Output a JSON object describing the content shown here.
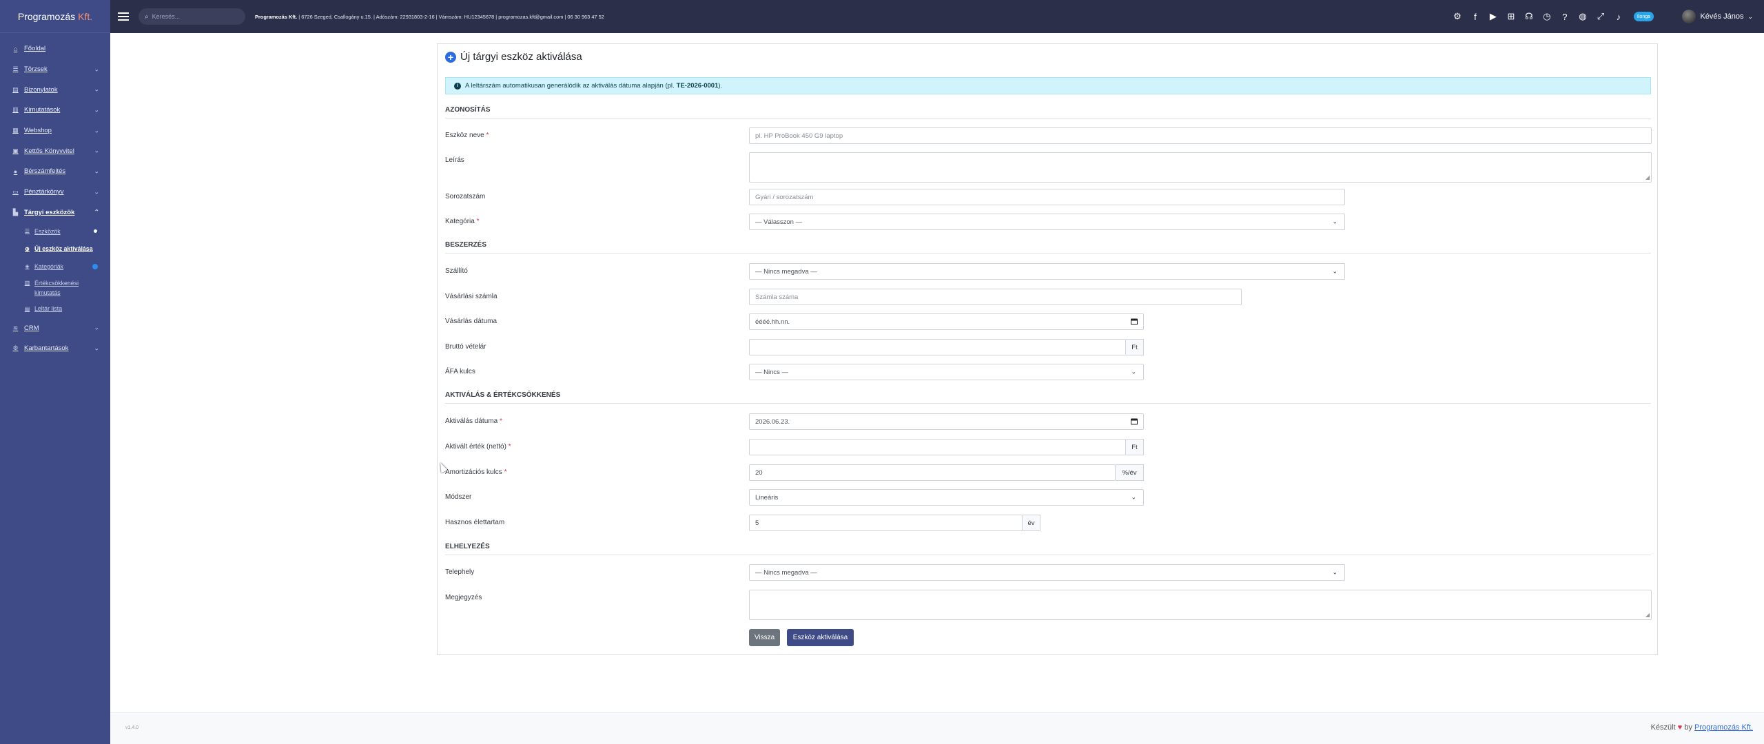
{
  "sidebar": {
    "brand": {
      "name": "Programozás",
      "suffix": "Kft."
    },
    "items": [
      {
        "label": "Főoldal",
        "icon": "dashboard-icon"
      },
      {
        "label": "Törzsek",
        "icon": "database-icon"
      },
      {
        "label": "Bizonylatok",
        "icon": "document-icon"
      },
      {
        "label": "Kimutatások",
        "icon": "chart-icon"
      },
      {
        "label": "Webshop",
        "icon": "shop-icon"
      },
      {
        "label": "Kettős Könyvvitel",
        "icon": "book-icon"
      },
      {
        "label": "Bérszámfejtés",
        "icon": "users-icon"
      },
      {
        "label": "Pénztárkönyv",
        "icon": "cash-icon"
      },
      {
        "label": "Tárgyi eszközök",
        "icon": "asset-icon"
      }
    ],
    "sub_items": [
      {
        "label": "Eszközök",
        "icon": "list-icon"
      },
      {
        "label": "Új eszköz aktiválása",
        "icon": "plus-circle-icon"
      },
      {
        "label": "Kategóriák",
        "icon": "tags-icon"
      },
      {
        "label": "Értékcsökkenési kimutatás",
        "icon": "chart-line-icon"
      },
      {
        "label": "Leltár lista",
        "icon": "clipboard-icon"
      }
    ],
    "after_items": [
      {
        "label": "CRM",
        "icon": "crm-icon"
      },
      {
        "label": "Karbantartások",
        "icon": "gear-icon"
      }
    ]
  },
  "topbar": {
    "search_placeholder": "Keresés...",
    "company_name": "Programozás Kft.",
    "company_info": "| 6726 Szeged, Csallogány u.15. | Adószám: 22931803-2-16 | Vámszám: HU12345678 | programozas.kft@gmail.com | 06 30 963 47 52",
    "badge": "Ilonga",
    "user": "Kévés János"
  },
  "form": {
    "title": "Új tárgyi eszköz aktiválása",
    "alert_text": "A leltárszám automatikusan generálódik az aktiválás dátuma alapján (pl.",
    "alert_code": "TE-2026-0001",
    "alert_end": ").",
    "sections": {
      "id": "AZONOSÍTÁS",
      "purchase": "BESZERZÉS",
      "activation": "AKTIVÁLÁS & ÉRTÉKCSÖKKENÉS",
      "placement": "ELHELYEZÉS"
    },
    "labels": {
      "name": "Eszköz neve",
      "description": "Leírás",
      "serial": "Sorozatszám",
      "category": "Kategória",
      "supplier": "Szállító",
      "invoice": "Vásárlási számla",
      "purchase_date": "Vásárlás dátuma",
      "gross": "Bruttó vételár",
      "vat": "ÁFA kulcs",
      "activation_date": "Aktiválás dátuma",
      "net": "Aktivált érték (nettó)",
      "amort": "Amortizációs kulcs",
      "method": "Módszer",
      "life": "Hasznos élettartam",
      "site": "Telephely",
      "note": "Megjegyzés"
    },
    "required": "*",
    "values": {
      "name_ph": "pl. HP ProBook 450 G9 laptop",
      "serial_ph": "Gyári / sorozatszám",
      "category": "— Válasszon —",
      "supplier": "— Nincs megadva —",
      "invoice_ph": "Számla száma",
      "purchase_date": "éééé.hh.nn.",
      "vat": "— Nincs —",
      "activation_date": "2026.06.23.",
      "amort": "20",
      "method": "Lineáris",
      "life": "5",
      "site": "— Nincs megadva —"
    },
    "units": {
      "ft": "Ft",
      "pct": "%/év",
      "year": "év"
    },
    "buttons": {
      "back": "Vissza",
      "save": "Eszköz aktiválása"
    }
  },
  "footer": {
    "version": "v1.4.0",
    "made": "Készült",
    "by": "by",
    "link": "Programozás Kft."
  }
}
